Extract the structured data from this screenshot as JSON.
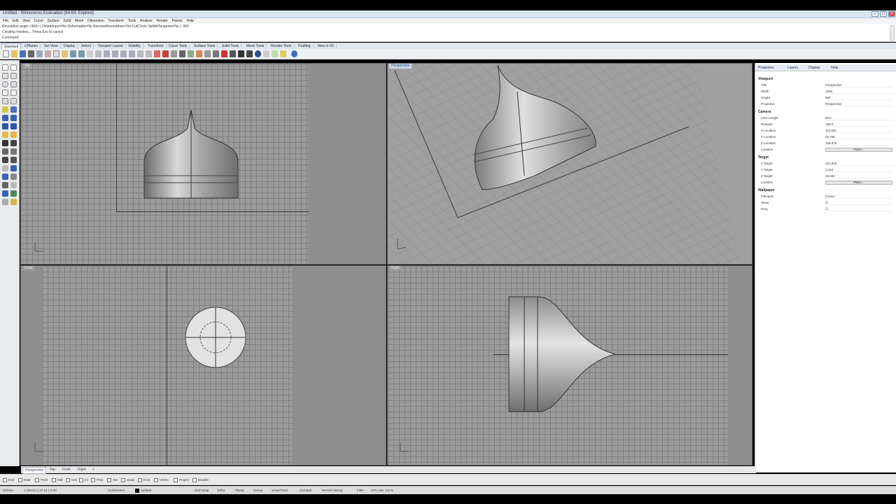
{
  "window": {
    "title": "Untitled - Rhinoceros Evaluation (64-bit, Expired)"
  },
  "menu": [
    "File",
    "Edit",
    "View",
    "Curve",
    "Surface",
    "Solid",
    "Mesh",
    "Dimension",
    "Transform",
    "Tools",
    "Analyze",
    "Render",
    "Panels",
    "Help"
  ],
  "command": {
    "history_line": "Revolution angle <360> ( DeleteInput=No Deformable=No RevolveAroundAxis=Yes FullCircle SplitAtTangents=No ): 360",
    "status_line": "Creating meshes... Press Esc to cancel",
    "prompt": "Command:"
  },
  "tabs": [
    "Standard",
    "CPlanes",
    "Set View",
    "Display",
    "Select",
    "Viewport Layout",
    "Visibility",
    "Transform",
    "Curve Tools",
    "Surface Tools",
    "Solid Tools",
    "Mesh Tools",
    "Render Tools",
    "Drafting",
    "New in V5"
  ],
  "viewports": {
    "top": "Top",
    "perspective": "Perspective",
    "front": "Front",
    "right": "Right"
  },
  "properties": {
    "tabs": [
      "Properties",
      "Layers",
      "Display",
      "Help"
    ],
    "viewport_section": "Viewport",
    "viewport_rows": [
      {
        "label": "Title",
        "value": "Perspective"
      },
      {
        "label": "Width",
        "value": "1009"
      },
      {
        "label": "Height",
        "value": "555"
      },
      {
        "label": "Projection",
        "value": "Perspective"
      }
    ],
    "camera_section": "Camera",
    "camera_rows": [
      {
        "label": "Lens Length",
        "value": "50.0"
      },
      {
        "label": "Rotation",
        "value": "180.0"
      },
      {
        "label": "X Location",
        "value": "112.691"
      },
      {
        "label": "Y Location",
        "value": "36.758"
      },
      {
        "label": "Z Location",
        "value": "108.975"
      }
    ],
    "camera_location_label": "Location",
    "camera_place_button": "Place...",
    "target_section": "Target",
    "target_rows": [
      {
        "label": "X Target",
        "value": "101.815"
      },
      {
        "label": "Y Target",
        "value": "3.164"
      },
      {
        "label": "Z Target",
        "value": "26.084"
      }
    ],
    "target_location_label": "Location",
    "target_place_button": "Place...",
    "wallpaper_section": "Wallpaper",
    "wallpaper_rows": [
      {
        "label": "Filename",
        "value": "(none)"
      },
      {
        "label": "Show",
        "value": "☑"
      },
      {
        "label": "Gray",
        "value": "☑"
      }
    ]
  },
  "bottom_tabs": [
    "Perspective",
    "Top",
    "Front",
    "Right"
  ],
  "osnaps": [
    "End",
    "Near",
    "Point",
    "Mid",
    "Cen",
    "Int",
    "Perp",
    "Tan",
    "Quad",
    "Knot",
    "Vertex",
    "Project",
    "Disable"
  ],
  "status": {
    "cplane": "CPlane",
    "coords": "x 150.51   y 27.13   z 0.00",
    "units": "Centimeters",
    "layer": "Default",
    "toggles": [
      "Grid Snap",
      "Ortho",
      "Planar",
      "Osnap",
      "SmartTrack",
      "Gumball",
      "Record History",
      "Filter"
    ],
    "cpu": "CPU use: 6.6 %"
  },
  "colors": {
    "viewport_bg": "#9b9b9b",
    "grid_line": "#7f7f7f",
    "active_tab": "#c9d6e6"
  }
}
